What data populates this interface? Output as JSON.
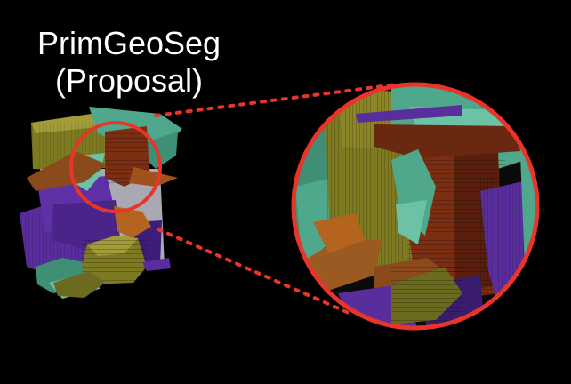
{
  "title": {
    "line1": "PrimGeoSeg",
    "line2": "(Proposal)"
  },
  "colors": {
    "background": "#000000",
    "title_text": "#ffffff",
    "callout_circle": "#e8352a",
    "connector_dots": "#e8352a",
    "olive": "#7d7a22",
    "olive_light": "#a29b3a",
    "teal": "#4fa78c",
    "teal_light": "#6cc2a5",
    "brown": "#7c2e12",
    "brown_dark": "#5a1f0c",
    "purple": "#5a2d9c",
    "purple_dark": "#3a1c6e",
    "orange": "#b5641f",
    "gray": "#a9a9b4"
  }
}
